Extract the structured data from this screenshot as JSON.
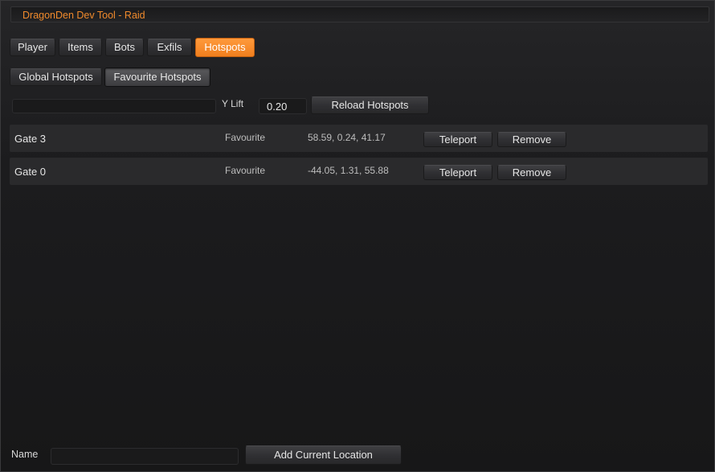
{
  "title": "DragonDen Dev Tool - Raid",
  "main_tabs": [
    {
      "label": "Player"
    },
    {
      "label": "Items"
    },
    {
      "label": "Bots"
    },
    {
      "label": "Exfils"
    },
    {
      "label": "Hotspots"
    }
  ],
  "active_tab": "Hotspots",
  "sub_tabs": [
    {
      "label": "Global Hotspots"
    },
    {
      "label": "Favourite Hotspots"
    }
  ],
  "active_sub_tab": "Favourite Hotspots",
  "controls": {
    "search_value": "",
    "y_lift_label": "Y Lift",
    "y_lift_value": "0.20",
    "reload_label": "Reload Hotspots"
  },
  "hotspots": [
    {
      "name": "Gate 3",
      "type": "Favourite",
      "coords": "58.59, 0.24, 41.17",
      "teleport": "Teleport",
      "remove": "Remove"
    },
    {
      "name": "Gate 0",
      "type": "Favourite",
      "coords": "-44.05, 1.31, 55.88",
      "teleport": "Teleport",
      "remove": "Remove"
    }
  ],
  "footer": {
    "name_label": "Name",
    "name_value": "",
    "add_label": "Add Current Location"
  },
  "colors": {
    "accent": "#f08a2c",
    "background": "#1c1c1e",
    "row": "#2a2a2c"
  }
}
